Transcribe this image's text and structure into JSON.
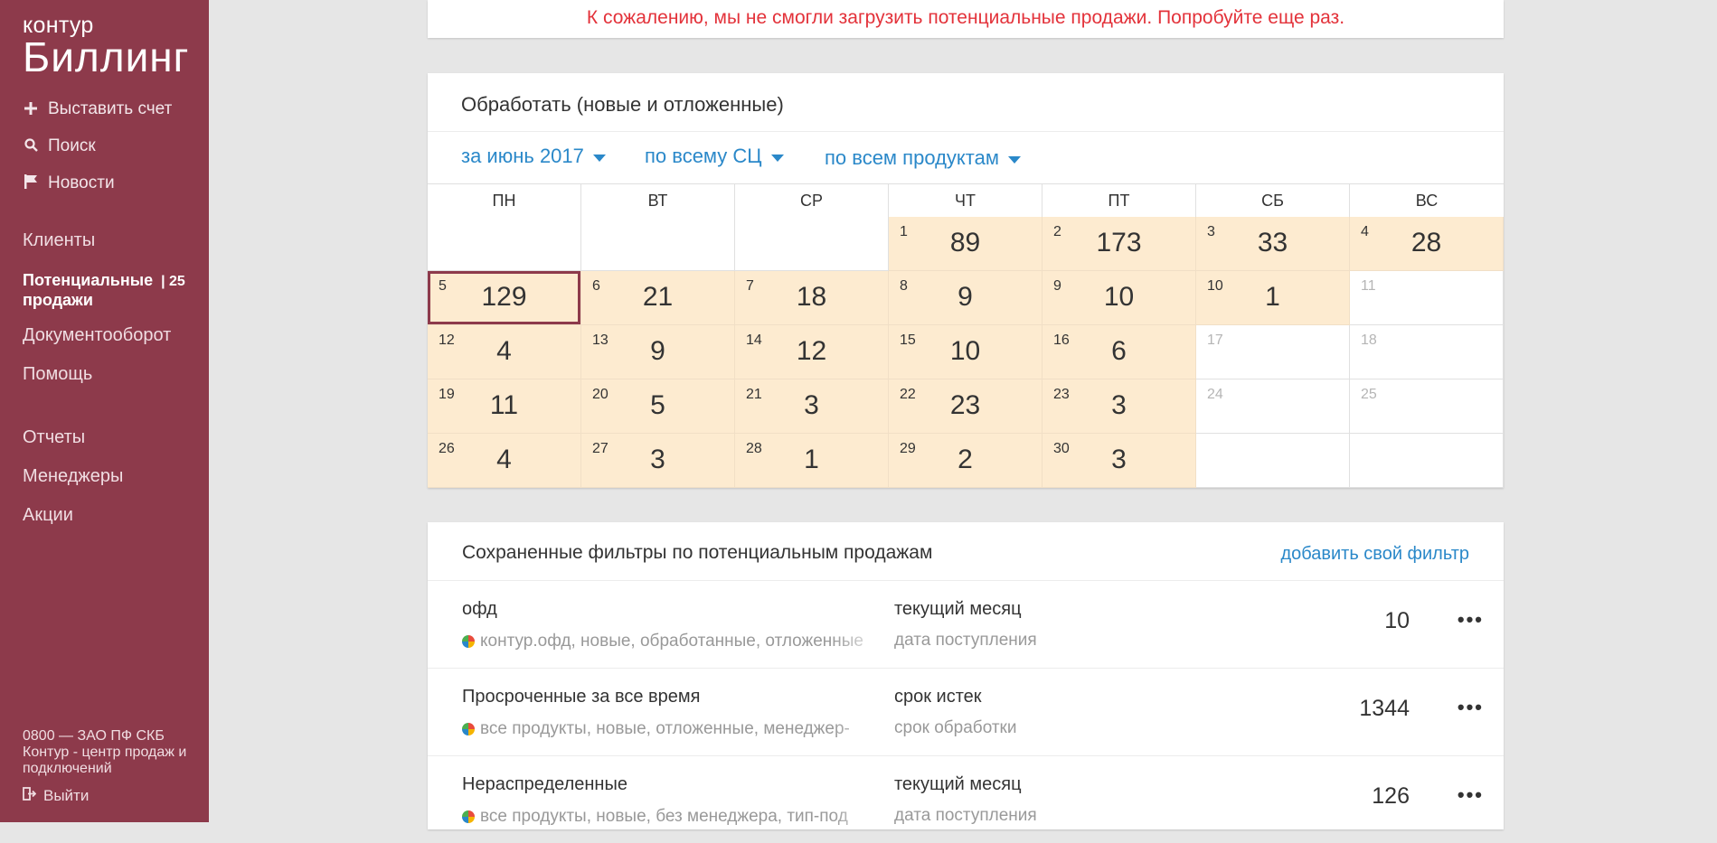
{
  "sidebar": {
    "logo_top": "контур",
    "logo_bottom": "Биллинг",
    "actions": [
      {
        "label": "Выставить счет",
        "icon": "plus-icon"
      },
      {
        "label": "Поиск",
        "icon": "search-icon"
      },
      {
        "label": "Новости",
        "icon": "flag-icon"
      }
    ],
    "nav": {
      "clients": "Клиенты",
      "potential_line1": "Потенциальные",
      "potential_line2": "продажи",
      "potential_count": "| 25",
      "docflow": "Документооборот",
      "help": "Помощь",
      "reports": "Отчеты",
      "managers": "Менеджеры",
      "promos": "Акции"
    },
    "footer": "0800 — ЗАО ПФ СКБ Контур - центр продаж и подключений",
    "logout": "Выйти"
  },
  "error": {
    "message": "К сожалению, мы не смогли загрузить потенциальные продажи. Попробуйте еще раз."
  },
  "calendar": {
    "title": "Обработать (новые и отложенные)",
    "filters": {
      "period": "за июнь 2017",
      "scope": "по всему СЦ",
      "products": "по всем продуктам"
    },
    "weekdays": [
      "ПН",
      "ВТ",
      "СР",
      "ЧТ",
      "ПТ",
      "СБ",
      "ВС"
    ],
    "cells": [
      {
        "day": "",
        "value": ""
      },
      {
        "day": "",
        "value": ""
      },
      {
        "day": "",
        "value": ""
      },
      {
        "day": "1",
        "value": "89"
      },
      {
        "day": "2",
        "value": "173"
      },
      {
        "day": "3",
        "value": "33"
      },
      {
        "day": "4",
        "value": "28"
      },
      {
        "day": "5",
        "value": "129"
      },
      {
        "day": "6",
        "value": "21"
      },
      {
        "day": "7",
        "value": "18"
      },
      {
        "day": "8",
        "value": "9"
      },
      {
        "day": "9",
        "value": "10"
      },
      {
        "day": "10",
        "value": "1"
      },
      {
        "day": "11",
        "value": ""
      },
      {
        "day": "12",
        "value": "4"
      },
      {
        "day": "13",
        "value": "9"
      },
      {
        "day": "14",
        "value": "12"
      },
      {
        "day": "15",
        "value": "10"
      },
      {
        "day": "16",
        "value": "6"
      },
      {
        "day": "17",
        "value": ""
      },
      {
        "day": "18",
        "value": ""
      },
      {
        "day": "19",
        "value": "11"
      },
      {
        "day": "20",
        "value": "5"
      },
      {
        "day": "21",
        "value": "3"
      },
      {
        "day": "22",
        "value": "23"
      },
      {
        "day": "23",
        "value": "3"
      },
      {
        "day": "24",
        "value": ""
      },
      {
        "day": "25",
        "value": ""
      },
      {
        "day": "26",
        "value": "4"
      },
      {
        "day": "27",
        "value": "3"
      },
      {
        "day": "28",
        "value": "1"
      },
      {
        "day": "29",
        "value": "2"
      },
      {
        "day": "30",
        "value": "3"
      },
      {
        "day": "",
        "value": ""
      },
      {
        "day": "",
        "value": ""
      }
    ],
    "selected_day": "5"
  },
  "saved_filters": {
    "title": "Сохраненные фильтры по потенциальным продажам",
    "add_label": "добавить свой фильтр",
    "rows": [
      {
        "name": "офд",
        "desc": "контур.офд, новые, обработанные, отложенные",
        "period": "текущий месяц",
        "basis": "дата поступления",
        "count": "10"
      },
      {
        "name": "Просроченные за все время",
        "desc": "все продукты, новые, отложенные, менеджер-",
        "period": "срок истек",
        "basis": "срок обработки",
        "count": "1344"
      },
      {
        "name": "Нераспределенные",
        "desc": "все продукты, новые, без менеджера, тип-под",
        "period": "текущий месяц",
        "basis": "дата поступления",
        "count": "126"
      }
    ],
    "menu_glyph": "•••"
  },
  "colors": {
    "sidebar": "#8d3a4b",
    "accent_blue": "#2a88c9",
    "error_red": "#e3323a",
    "calendar_fill": "#fdebd0"
  }
}
